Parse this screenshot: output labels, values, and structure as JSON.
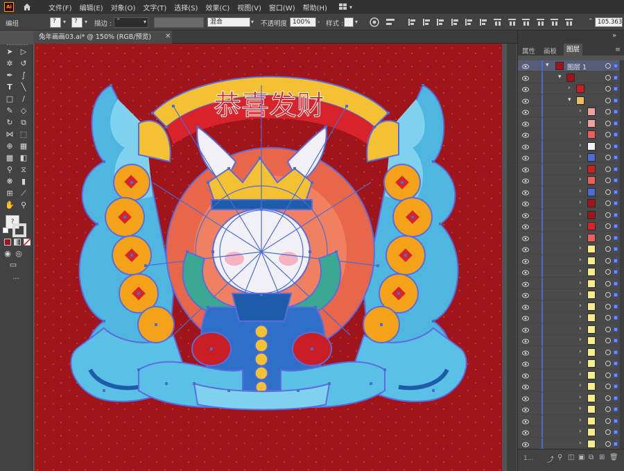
{
  "menubar": {
    "items": [
      "文件(F)",
      "编辑(E)",
      "对象(O)",
      "文字(T)",
      "选择(S)",
      "效果(C)",
      "视图(V)",
      "窗口(W)",
      "帮助(H)"
    ]
  },
  "control_bar": {
    "selection_label": "编组",
    "stroke_label": "描边 :",
    "blend_value": "混合",
    "opacity_label": "不透明度 :",
    "opacity_value": "100%",
    "style_label": "样式 :",
    "coord_value": "105.363"
  },
  "document": {
    "tab_title": "兔年画画03.ai* @ 150% (RGB/预览)"
  },
  "artwork": {
    "banner_text": "恭喜发财"
  },
  "panel": {
    "tabs": [
      "属性",
      "画板",
      "图层"
    ],
    "active_tab": "图层",
    "layer_name": "图层 1"
  },
  "colors": {
    "artboard": "#a0151c",
    "selection": "#4a6cd4",
    "app_bg": "#535353"
  }
}
